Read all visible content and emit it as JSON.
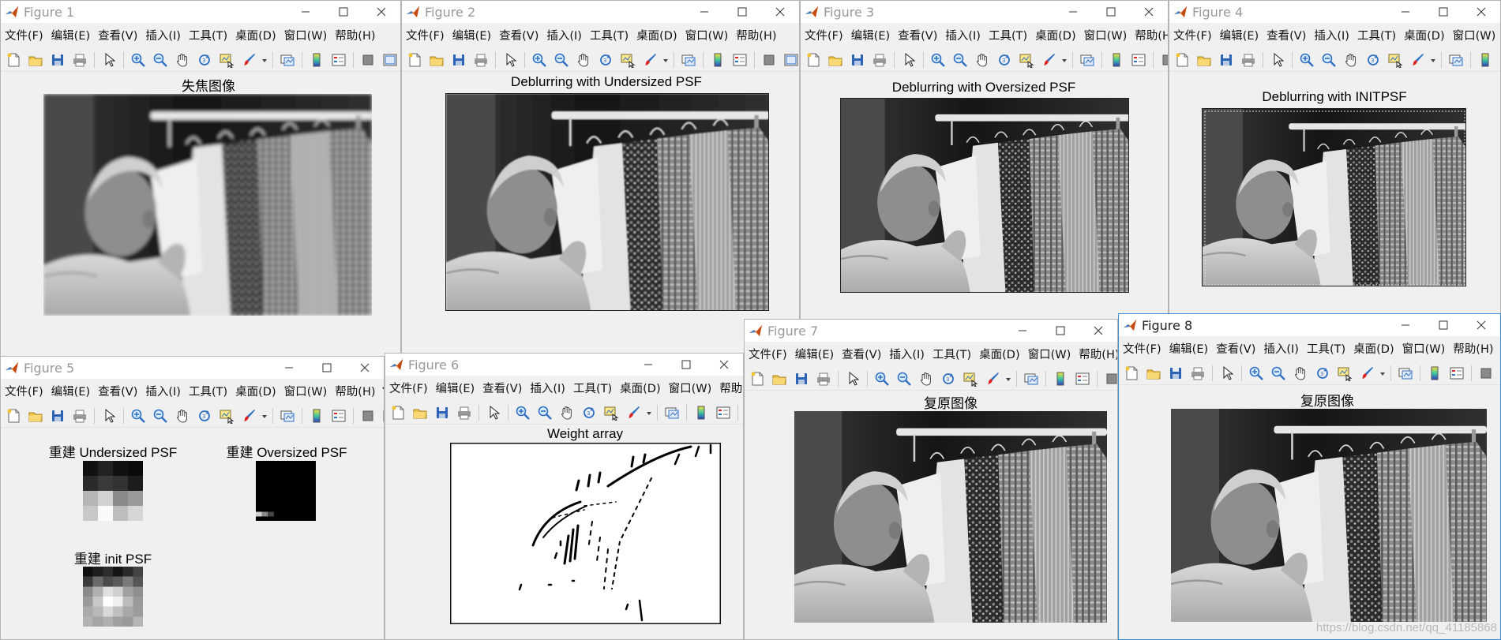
{
  "menus": [
    "文件(F)",
    "编辑(E)",
    "查看(V)",
    "插入(I)",
    "工具(T)",
    "桌面(D)",
    "窗口(W)",
    "帮助(H)"
  ],
  "figures": {
    "fig1": {
      "title": "Figure 1",
      "axes_title": "失焦图像"
    },
    "fig2": {
      "title": "Figure 2",
      "axes_title": "Deblurring with Undersized PSF"
    },
    "fig3": {
      "title": "Figure 3",
      "axes_title": "Deblurring with Oversized PSF"
    },
    "fig4": {
      "title": "Figure 4",
      "axes_title": "Deblurring with INITPSF"
    },
    "fig5": {
      "title": "Figure 5",
      "psf_titles": [
        "重建 Undersized PSF",
        "重建 Oversized PSF",
        "重建  init PSF"
      ]
    },
    "fig6": {
      "title": "Figure 6",
      "axes_title": "Weight array"
    },
    "fig7": {
      "title": "Figure 7",
      "axes_title": "复原图像"
    },
    "fig8": {
      "title": "Figure 8",
      "axes_title": "复原图像"
    }
  },
  "watermark": "https://blog.csdn.net/qq_41185868",
  "colors": {
    "titlebar": "#ffffff",
    "window_bg": "#f0f0f0",
    "active_border": "#3c8fd6",
    "matlab_orange": "#e8741e"
  }
}
